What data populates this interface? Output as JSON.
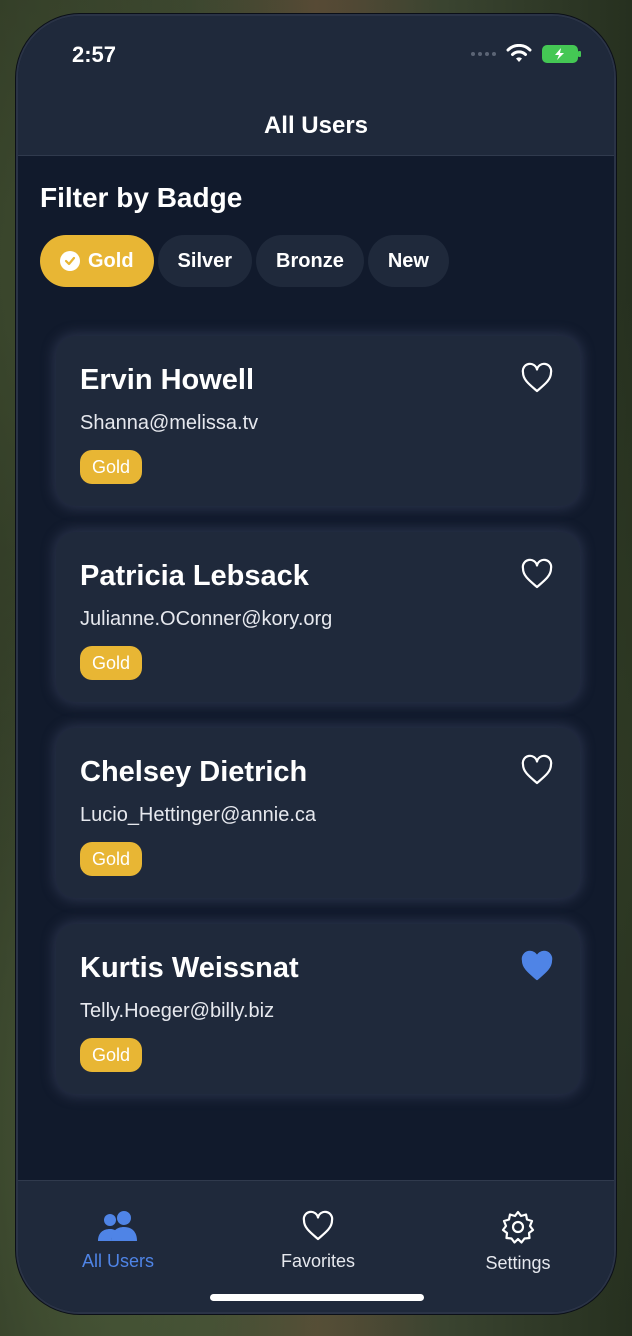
{
  "status": {
    "time": "2:57"
  },
  "header": {
    "title": "All Users"
  },
  "filter": {
    "title": "Filter by Badge",
    "chips": [
      {
        "label": "Gold",
        "active": true
      },
      {
        "label": "Silver",
        "active": false
      },
      {
        "label": "Bronze",
        "active": false
      },
      {
        "label": "New",
        "active": false
      }
    ]
  },
  "users": [
    {
      "name": "Ervin Howell",
      "email": "Shanna@melissa.tv",
      "badge": "Gold",
      "favorite": false
    },
    {
      "name": "Patricia Lebsack",
      "email": "Julianne.OConner@kory.org",
      "badge": "Gold",
      "favorite": false
    },
    {
      "name": "Chelsey Dietrich",
      "email": "Lucio_Hettinger@annie.ca",
      "badge": "Gold",
      "favorite": false
    },
    {
      "name": "Kurtis Weissnat",
      "email": "Telly.Hoeger@billy.biz",
      "badge": "Gold",
      "favorite": true
    }
  ],
  "tabs": [
    {
      "label": "All Users",
      "icon": "users-icon",
      "active": true
    },
    {
      "label": "Favorites",
      "icon": "heart-icon",
      "active": false
    },
    {
      "label": "Settings",
      "icon": "gear-icon",
      "active": false
    }
  ],
  "colors": {
    "accent": "#4f84e6",
    "gold": "#e8b634",
    "card": "#1f293b",
    "background": "#111a2c"
  }
}
